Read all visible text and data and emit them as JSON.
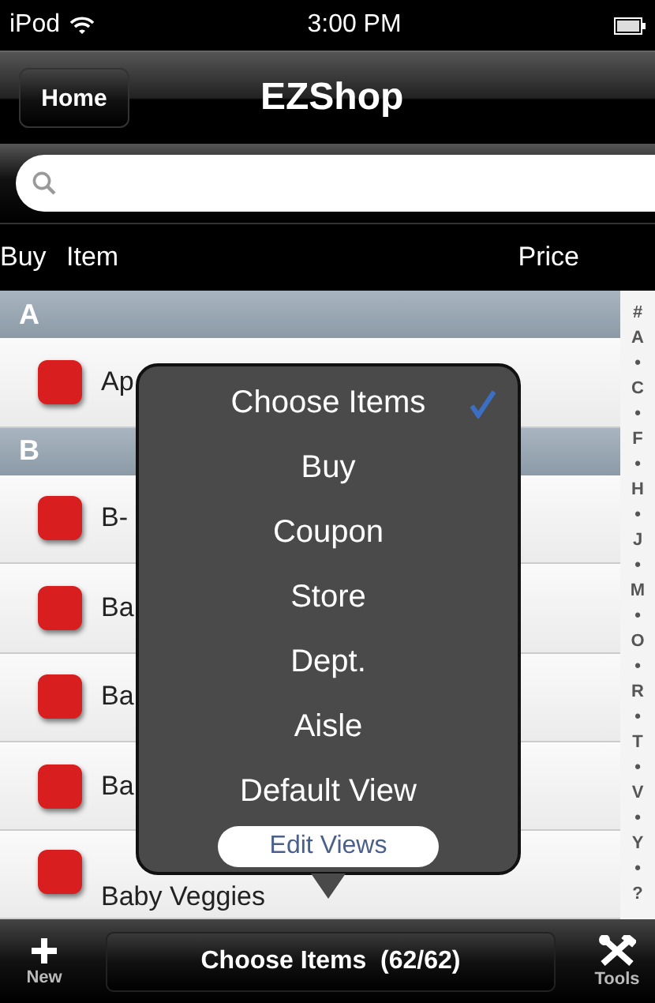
{
  "status_bar": {
    "carrier": "iPod",
    "time": "3:00 PM"
  },
  "nav_bar": {
    "back_button": "Home",
    "title": "EZShop"
  },
  "columns": [
    "Buy",
    "Item",
    "Price"
  ],
  "sections": [
    {
      "header": "A",
      "items": [
        {
          "name": "Ap",
          "marked": true
        }
      ]
    },
    {
      "header": "B",
      "items": [
        {
          "name": "B-",
          "marked": true
        },
        {
          "name": "Ba",
          "marked": true
        },
        {
          "name": "Ba",
          "marked": true
        },
        {
          "name": "Ba",
          "marked": true
        },
        {
          "name": "Baby Veggies",
          "marked": true
        }
      ]
    }
  ],
  "index": [
    "#",
    "A",
    "•",
    "C",
    "•",
    "F",
    "•",
    "H",
    "•",
    "J",
    "•",
    "M",
    "•",
    "O",
    "•",
    "R",
    "•",
    "T",
    "•",
    "V",
    "•",
    "Y",
    "•",
    "?"
  ],
  "popup": {
    "options": [
      {
        "label": "Choose Items",
        "selected": true
      },
      {
        "label": "Buy",
        "selected": false
      },
      {
        "label": "Coupon",
        "selected": false
      },
      {
        "label": "Store",
        "selected": false
      },
      {
        "label": "Dept.",
        "selected": false
      },
      {
        "label": "Aisle",
        "selected": false
      },
      {
        "label": "Default View",
        "selected": false
      }
    ],
    "edit_button": "Edit Views"
  },
  "toolbar": {
    "new_label": "New",
    "choose_button": "Choose Items  (62/62)",
    "tools_label": "Tools"
  }
}
